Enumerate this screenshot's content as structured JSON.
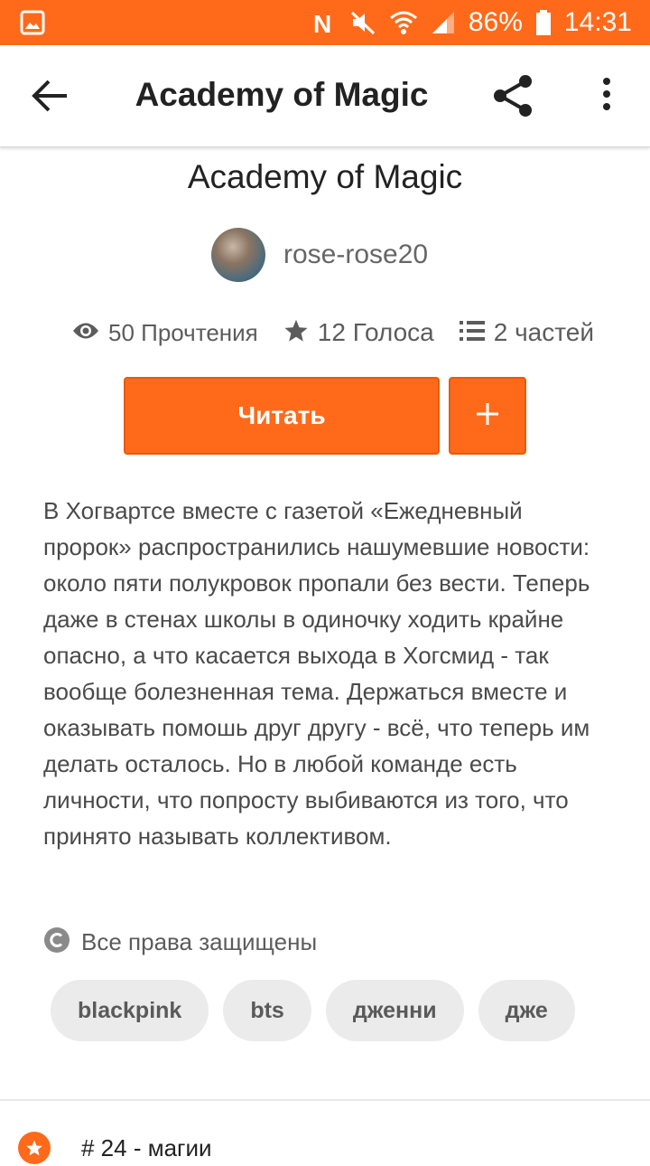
{
  "status_bar": {
    "battery": "86%",
    "time": "14:31",
    "icons": [
      "image-notification-icon",
      "nfc-icon",
      "mute-icon",
      "wifi-icon",
      "signal-icon",
      "battery-icon"
    ]
  },
  "app_bar": {
    "title": "Academy of Magic",
    "icons": [
      "back-arrow-icon",
      "share-icon",
      "more-vert-icon"
    ]
  },
  "story": {
    "title": "Academy of Magic",
    "author": "rose-rose20",
    "stats": {
      "reads": "50 Прочтения",
      "votes": "12 Голоса",
      "parts": "2 частей"
    },
    "read_button": "Читать",
    "add_button": "+",
    "description": "В Хогвартсе вместе с газетой «Ежедневный пророк» распространились нашумевшие новости: около пяти полукровок пропали без вести. Теперь даже в стенах школы в одиночку ходить крайне опасно, а что касается выхода в Хогсмид - так вообще болезненная тема. Держаться вместе и оказывать помошь друг другу - всё, что теперь им делать осталось. Но в любой команде есть личности, что попросту выбиваются из того, что принято называть коллективом.",
    "copyright": "Все права защищены",
    "tags": [
      "blackpink",
      "bts",
      "дженни",
      "дже"
    ],
    "rank": "# 24 - магии"
  },
  "colors": {
    "accent": "#ff6a1a",
    "tag_bg": "#ebebeb",
    "text_muted": "#5c5c5c"
  }
}
